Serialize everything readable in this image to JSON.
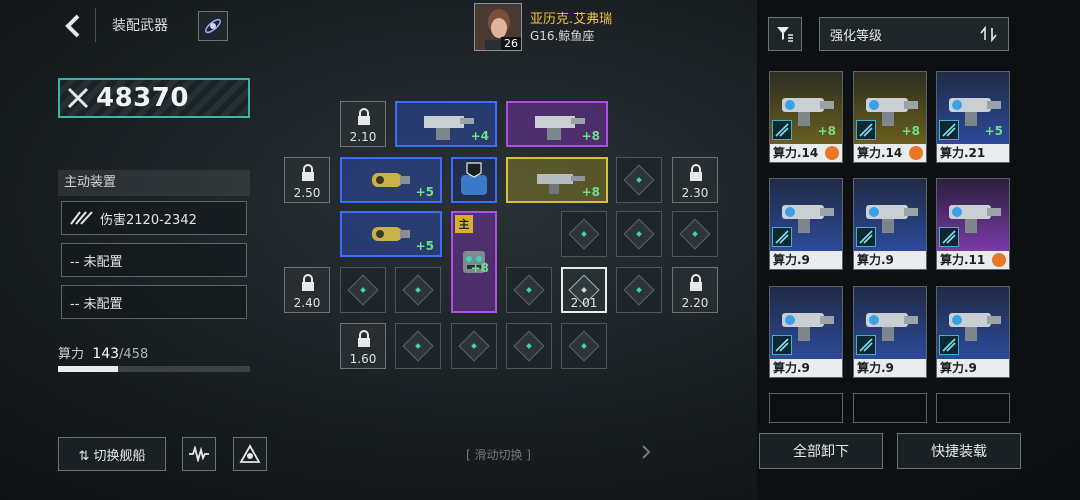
{
  "header": {
    "title": "装配武器",
    "pilot": {
      "name": "亚历克.艾弗瑞",
      "level": "26",
      "ship": "G16.鲸鱼座"
    }
  },
  "left": {
    "power": "48370",
    "active_title": "主动装置",
    "slots": [
      {
        "text": "伤害2120-2342"
      },
      {
        "text": "-- 未配置"
      },
      {
        "text": "-- 未配置"
      }
    ],
    "compute": {
      "label": "算力",
      "used": "143",
      "total": "/458",
      "fraction": 0.31
    },
    "switch_ship": "⇅ 切换舰船"
  },
  "grid": {
    "multipliers": {
      "m1": "2.10",
      "m2": "2.50",
      "m3": "2.30",
      "m4": "2.40",
      "m5": "2.20",
      "m6": "1.60",
      "selected": "2.01"
    },
    "equip_levels": {
      "e1": "+4",
      "e2": "+8",
      "e3": "+5",
      "e4": "+8",
      "e5": "+5",
      "e6": "+8"
    },
    "main_tag": "主",
    "swipe_hint": "[ 滑动切换 ]"
  },
  "right": {
    "sort_label": "强化等级",
    "cards": [
      {
        "label": "算力.14",
        "lvl": "+8",
        "rarity": "yellow",
        "badge": true
      },
      {
        "label": "算力.14",
        "lvl": "+8",
        "rarity": "yellow",
        "badge": true
      },
      {
        "label": "算力.21",
        "lvl": "+5",
        "rarity": "blue",
        "badge": false
      },
      {
        "label": "算力.9",
        "lvl": "",
        "rarity": "blue",
        "badge": false
      },
      {
        "label": "算力.9",
        "lvl": "",
        "rarity": "blue",
        "badge": false
      },
      {
        "label": "算力.11",
        "lvl": "",
        "rarity": "purple",
        "badge": true
      },
      {
        "label": "算力.9",
        "lvl": "",
        "rarity": "blue",
        "badge": false
      },
      {
        "label": "算力.9",
        "lvl": "",
        "rarity": "blue",
        "badge": false
      },
      {
        "label": "算力.9",
        "lvl": "",
        "rarity": "blue",
        "badge": false
      }
    ],
    "unequip_all": "全部卸下",
    "quick_equip": "快捷装载"
  },
  "colors": {
    "accent": "#3fb3a6",
    "pilot_name": "#f2c33a",
    "blue": "#3d6cff",
    "purple": "#b04de6",
    "yellow": "#d8c23a"
  }
}
